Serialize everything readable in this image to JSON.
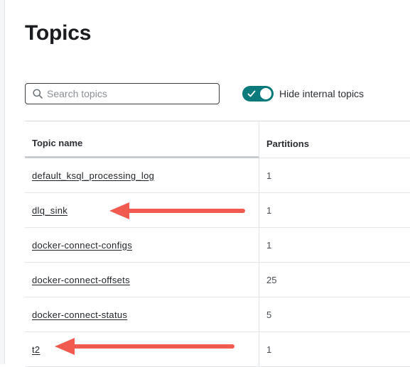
{
  "page": {
    "title": "Topics"
  },
  "search": {
    "placeholder": "Search topics",
    "value": ""
  },
  "toggle": {
    "label": "Hide internal topics",
    "checked": true,
    "color": "#0a7a7d"
  },
  "table": {
    "columns": [
      "Topic name",
      "Partitions"
    ],
    "rows": [
      {
        "name": "default_ksql_processing_log",
        "partitions": "1"
      },
      {
        "name": "dlq_sink",
        "partitions": "1"
      },
      {
        "name": "docker-connect-configs",
        "partitions": "1"
      },
      {
        "name": "docker-connect-offsets",
        "partitions": "25"
      },
      {
        "name": "docker-connect-status",
        "partitions": "5"
      },
      {
        "name": "t2",
        "partitions": "1"
      }
    ]
  },
  "annotations": {
    "arrow_color": "#f15a4f"
  }
}
